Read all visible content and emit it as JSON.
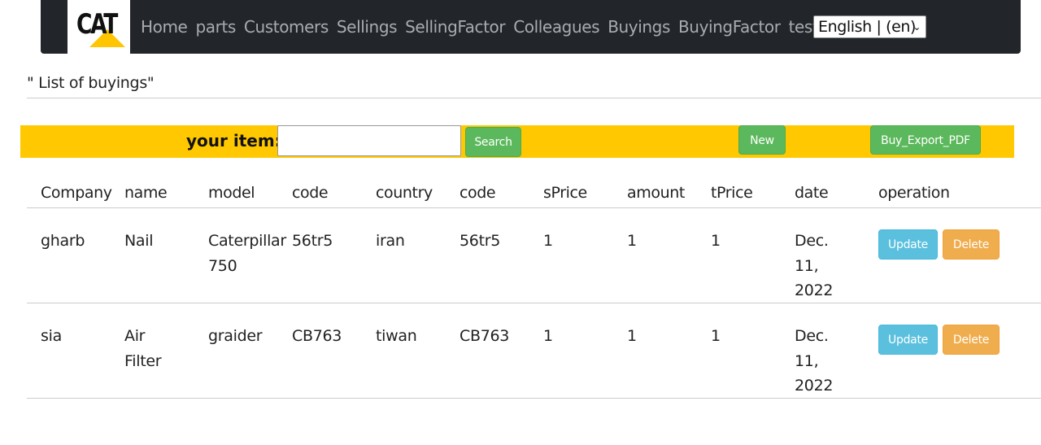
{
  "nav": {
    "logo_text": "CAT",
    "links": [
      "Home",
      "parts",
      "Customers",
      "Sellings",
      "SellingFactor",
      "Colleagues",
      "Buyings",
      "BuyingFactor",
      "test"
    ],
    "language": "English | (en)"
  },
  "page": {
    "title": "\" List of buyings\""
  },
  "search": {
    "label": "your item:",
    "value": "",
    "search_button": "Search",
    "new_button": "New",
    "export_button": "Buy_Export_PDF"
  },
  "table": {
    "headers": [
      "Company",
      "name",
      "model",
      "code",
      "country",
      "code",
      "sPrice",
      "amount",
      "tPrice",
      "date",
      "operation"
    ],
    "rows": [
      {
        "company": "gharb",
        "name": "Nail",
        "model": "Caterpillar 750",
        "code": "56tr5",
        "country": "iran",
        "code2": "56tr5",
        "sprice": "1",
        "amount": "1",
        "tprice": "1",
        "date": "Dec. 11, 2022",
        "update": "Update",
        "delete": "Delete"
      },
      {
        "company": "sia",
        "name": "Air Filter",
        "model": "graider",
        "code": "CB763",
        "country": "tiwan",
        "code2": "CB763",
        "sprice": "1",
        "amount": "1",
        "tprice": "1",
        "date": "Dec. 11, 2022",
        "update": "Update",
        "delete": "Delete"
      }
    ]
  },
  "colors": {
    "navbar": "#222529",
    "search_bar": "#ffc800",
    "green": "#5cb85c",
    "info": "#5bc0de",
    "warning": "#f0ad4e"
  }
}
